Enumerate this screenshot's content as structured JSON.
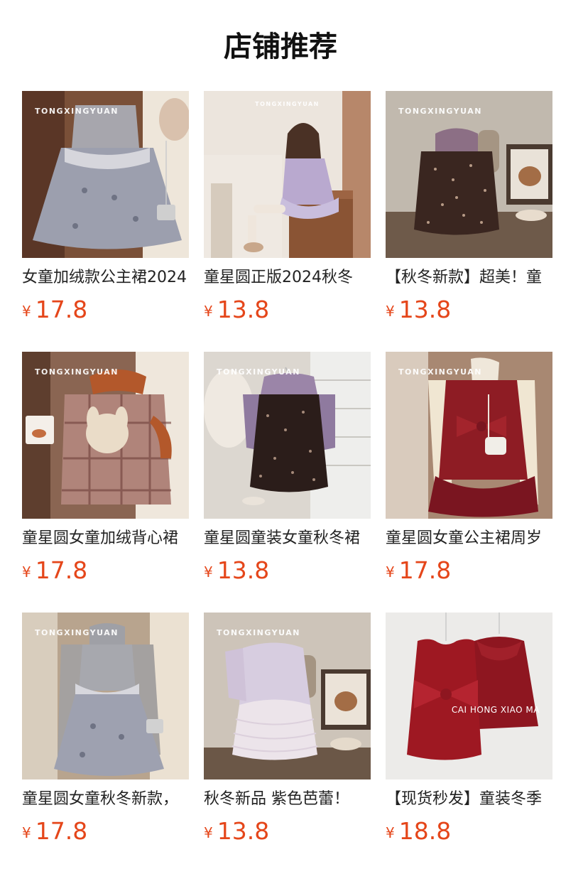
{
  "section_title": "店铺推荐",
  "products": [
    {
      "name": "女童加绒款公主裙2024",
      "currency": "¥",
      "price": "17.8",
      "watermark": "TONGXINGYUAN",
      "image": "grey-sequin-tutu-dress",
      "bg": "#7a5038"
    },
    {
      "name": "童星圆正版2024秋冬",
      "currency": "¥",
      "price": "13.8",
      "watermark": "TONGXINGYUAN",
      "image": "girl-sitting-lilac-outfit",
      "bg": "#e9e2da"
    },
    {
      "name": "【秋冬新款】超美！童",
      "currency": "¥",
      "price": "13.8",
      "watermark": "TONGXINGYUAN",
      "image": "floral-bubble-dress",
      "bg": "#bfb7ae"
    },
    {
      "name": "童星圆女童加绒背心裙",
      "currency": "¥",
      "price": "17.8",
      "watermark": "TONGXINGYUAN",
      "image": "plaid-bunny-pinafore",
      "bg": "#8a6552"
    },
    {
      "name": "童星圆童装女童秋冬裙",
      "currency": "¥",
      "price": "13.8",
      "watermark": "TONGXINGYUAN",
      "image": "purple-floral-dress-hanger",
      "bg": "#dcd7d0"
    },
    {
      "name": "童星圆女童公主裙周岁",
      "currency": "¥",
      "price": "17.8",
      "watermark": "TONGXINGYUAN",
      "image": "red-velvet-bow-dress",
      "bg": "#a88872"
    },
    {
      "name": "童星圆女童秋冬新款，",
      "currency": "¥",
      "price": "17.8",
      "watermark": "TONGXINGYUAN",
      "image": "grey-sequin-knit-dress",
      "bg": "#b8a48e"
    },
    {
      "name": "秋冬新品 紫色芭蕾！",
      "currency": "¥",
      "price": "13.8",
      "watermark": "TONGXINGYUAN",
      "image": "lilac-ballet-tutu-dress",
      "bg": "#cdc4b9"
    },
    {
      "name": "【现货秒发】童装冬季",
      "currency": "¥",
      "price": "18.8",
      "watermark": "CAI HONG XIAO MA",
      "image": "red-bow-dress-and-cape",
      "bg": "#ecebe9"
    }
  ]
}
